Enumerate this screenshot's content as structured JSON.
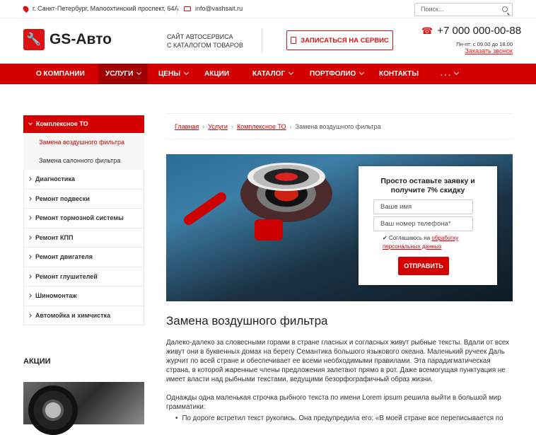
{
  "topbar": {
    "address": "г. Санкт-Петербург, Малоохтинский проспект, 64А",
    "email": "info@vashsait.ru",
    "search_placeholder": "Поиск..."
  },
  "header": {
    "logo_text": "GS-Авто",
    "tagline_line1": "Сайт автосервиса",
    "tagline_line2": "с каталогом товаров",
    "cta_label": "Записаться на сервис",
    "phone": "+7 000 000-00-88",
    "hours": "Пн-пт: с 09.00 до 18.00",
    "callback_link": "Заказать звонок"
  },
  "nav": {
    "items": [
      "О компании",
      "Услуги",
      "Цены",
      "Акции",
      "Каталог",
      "Портфолио",
      "Контакты",
      ". . ."
    ]
  },
  "sidebar": {
    "active_section": "Комплексное ТО",
    "subitems": [
      "Замена воздушного фильтра",
      "Замена салонного фильтра"
    ],
    "items": [
      "Диагностика",
      "Ремонт подвески",
      "Ремонт тормозной системы",
      "Ремонт КПП",
      "Ремонт двигателя",
      "Ремонт глушителей",
      "Шиномонтаж",
      "Автомойка и химчистка"
    ],
    "promo_heading": "Акции"
  },
  "breadcrumb": {
    "home": "Главная",
    "services": "Услуги",
    "section": "Комплексное ТО",
    "current": "Замена воздушного фильтра"
  },
  "form": {
    "title_line1": "Просто оставьте заявку и",
    "title_line2": "получите 7% скидку",
    "name_placeholder": "Ваше имя",
    "phone_placeholder": "Ваш номер телефона*",
    "consent_text": "Соглашаюсь на",
    "consent_link": "обработку персональных данных",
    "submit_label": "Отправить"
  },
  "content": {
    "title": "Замена воздушного фильтра",
    "paragraph1": "Далеко-далеко за словесными горами в стране гласных и согласных живут рыбные тексты. Вдали от всех живут они в буквенных домах на берегу Семантика большого языкового океана. Маленький ручеек Даль журчит по всей стране и обеспечивает ее всеми необходимыми правилами. Эта парадигматическая страна, в которой жаренные члены предложения залетают прямо в рот. Даже всемогущая пунктуация не имеет власти над рыбными текстами, ведущими безорфографичный образ жизни.",
    "paragraph2": "Однажды одна маленькая строчка рыбного текста по имени Lorem ipsum решила выйти в большой мир грамматики:",
    "bullet1": "По дороге встретил текст рукопись. Она предупредила его: «В моей стране все переписывается по"
  },
  "colors": {
    "accent": "#d40000",
    "accent_dark": "#a00000"
  }
}
